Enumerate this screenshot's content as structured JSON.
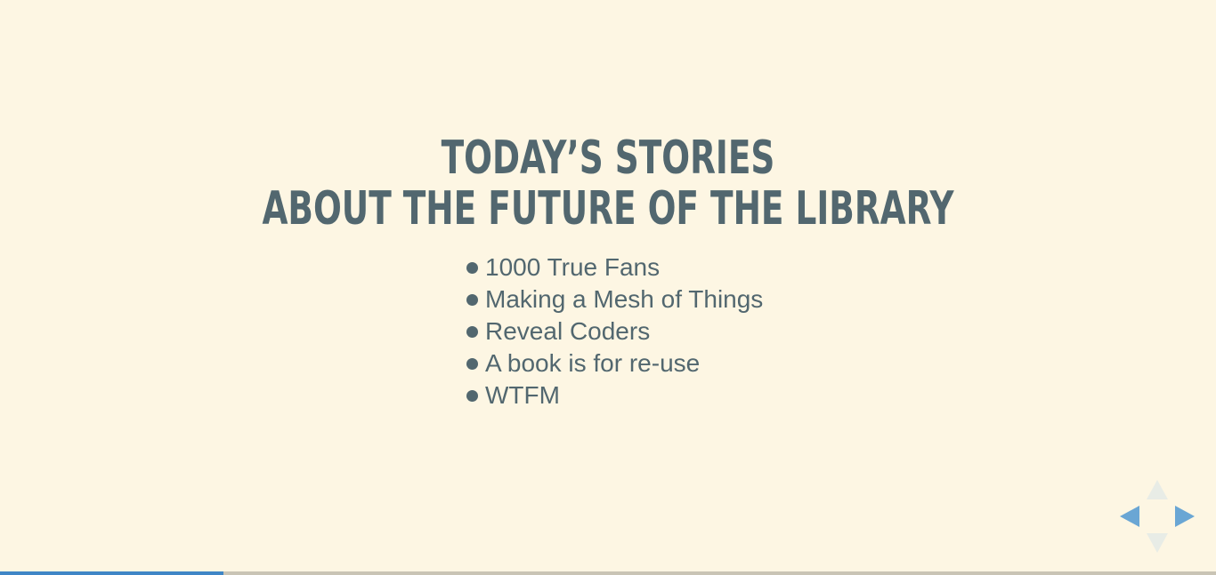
{
  "slide": {
    "title_line1": "Today’s Stories",
    "title_line2": "About the Future of the Library",
    "stories": [
      "1000 True Fans",
      "Making a Mesh of Things",
      "Reveal Coders",
      "A book is for re-use",
      "WTFM"
    ]
  },
  "controls": {
    "left_icon": "triangle-left",
    "right_icon": "triangle-right",
    "up_icon": "triangle-up",
    "down_icon": "triangle-down",
    "enabled_color": "#6aa6d4",
    "disabled_color": "#e8ece6"
  },
  "progress": {
    "fraction": 0.184,
    "fill_color": "#3f86c6"
  },
  "colors": {
    "background": "#fdf6e3",
    "text": "#52676f"
  }
}
